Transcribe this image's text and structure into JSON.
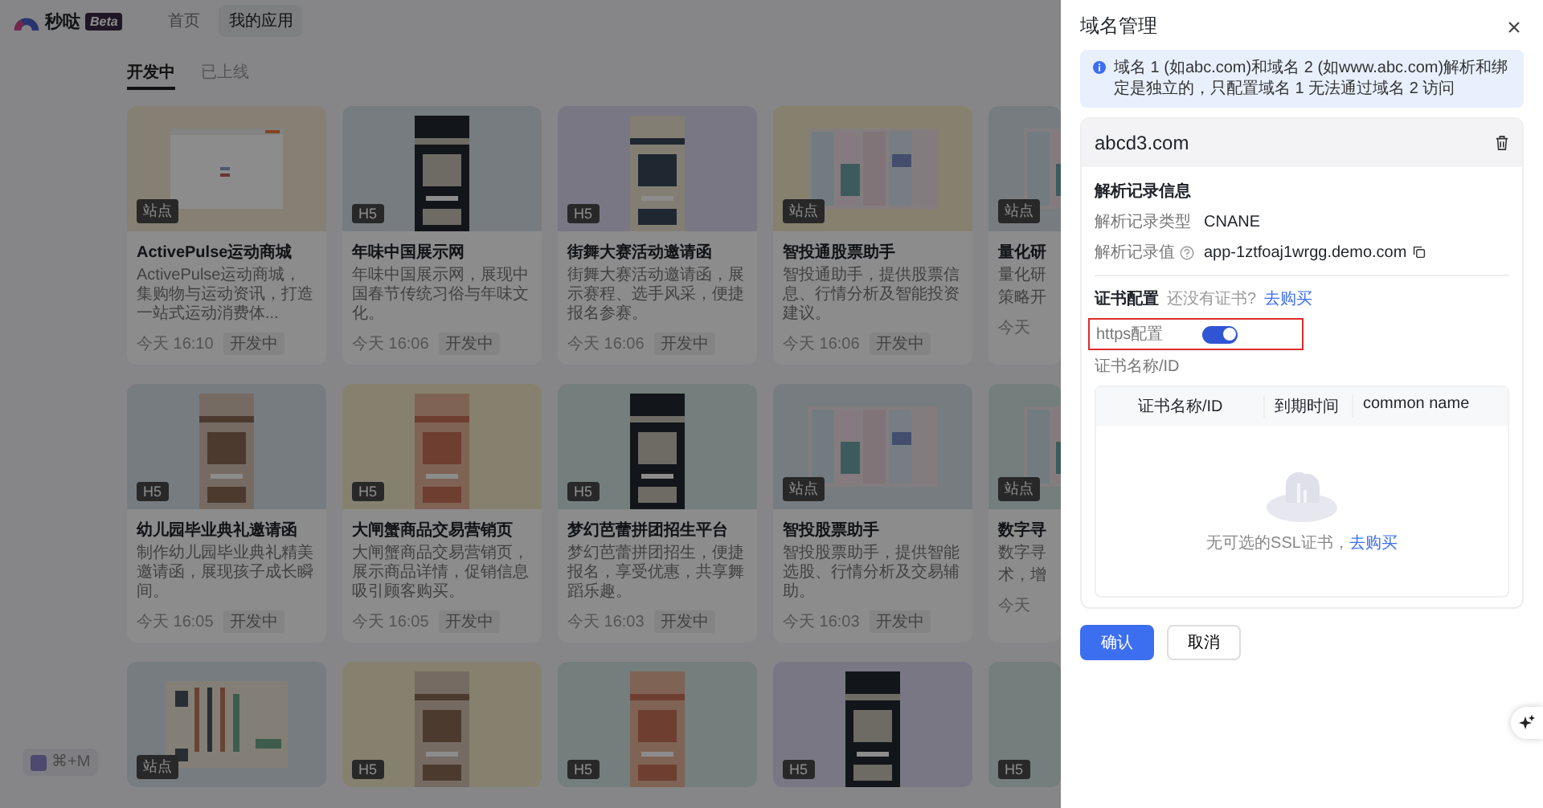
{
  "header": {
    "logo_text": "秒哒",
    "logo_badge": "Beta",
    "nav": [
      {
        "label": "首页",
        "selected": false
      },
      {
        "label": "我的应用",
        "selected": true
      }
    ]
  },
  "tabs": [
    {
      "label": "开发中",
      "selected": true
    },
    {
      "label": "已上线",
      "selected": false
    }
  ],
  "cards": [
    {
      "kind": "full",
      "badge": "站点",
      "title": "ActivePulse运动商城",
      "desc": "ActivePulse运动商城，集购物与运动资讯，打造一站式运动消费体...",
      "time": "今天 16:10",
      "status": "开发中"
    },
    {
      "kind": "full",
      "badge": "H5",
      "title": "年味中国展示网",
      "desc": "年味中国展示网，展现中国春节传统习俗与年味文化。",
      "time": "今天 16:06",
      "status": "开发中"
    },
    {
      "kind": "full",
      "badge": "H5",
      "title": "街舞大赛活动邀请函",
      "desc": "街舞大赛活动邀请函，展示赛程、选手风采，便捷报名参赛。",
      "time": "今天 16:06",
      "status": "开发中"
    },
    {
      "kind": "full",
      "badge": "站点",
      "title": "智投通股票助手",
      "desc": "智投通助手，提供股票信息、行情分析及智能投资建议。",
      "time": "今天 16:06",
      "status": "开发中"
    },
    {
      "kind": "partial",
      "badge": "站点",
      "title": "量化研",
      "desc_lines": [
        "量化研",
        "策略开"
      ],
      "time": "今天"
    },
    {
      "kind": "full",
      "badge": "H5",
      "title": "幼儿园毕业典礼邀请函",
      "desc": "制作幼儿园毕业典礼精美邀请函，展现孩子成长瞬间。",
      "time": "今天 16:05",
      "status": "开发中"
    },
    {
      "kind": "full",
      "badge": "H5",
      "title": "大闸蟹商品交易营销页",
      "desc": "大闸蟹商品交易营销页，展示商品详情，促销信息吸引顾客购买。",
      "time": "今天 16:05",
      "status": "开发中"
    },
    {
      "kind": "full",
      "badge": "H5",
      "title": "梦幻芭蕾拼团招生平台",
      "desc": "梦幻芭蕾拼团招生，便捷报名，享受优惠，共享舞蹈乐趣。",
      "time": "今天 16:03",
      "status": "开发中"
    },
    {
      "kind": "full",
      "badge": "站点",
      "title": "智投股票助手",
      "desc": "智投股票助手，提供智能选股、行情分析及交易辅助。",
      "time": "今天 16:03",
      "status": "开发中"
    },
    {
      "kind": "partial",
      "badge": "站点",
      "title": "数字寻",
      "desc_lines": [
        "数字寻",
        "术，增"
      ],
      "time": "今天"
    },
    {
      "kind": "full",
      "badge": "站点"
    },
    {
      "kind": "full",
      "badge": "H5"
    },
    {
      "kind": "full",
      "badge": "H5"
    },
    {
      "kind": "full",
      "badge": "H5"
    },
    {
      "kind": "partial",
      "badge": "H5"
    }
  ],
  "shortcut": {
    "label": "⌘+M"
  },
  "drawer": {
    "title": "域名管理",
    "notice": "域名 1 (如abc.com)和域名 2 (如www.abc.com)解析和绑定是独立的，只配置域名 1 无法通过域名 2 访问",
    "domain": "abcd3.com",
    "record_section": "解析记录信息",
    "records": [
      {
        "kind": "plain",
        "label": "解析记录类型",
        "value": "CNANE"
      },
      {
        "kind": "help_copy",
        "label": "解析记录值",
        "value": "app-1ztfoaj1wrgg.demo.com"
      }
    ],
    "cert_section": "证书配置",
    "cert_hint": "还没有证书?",
    "cert_link": "去购买",
    "https": {
      "label": "https配置",
      "on": true,
      "highlighted": true
    },
    "cert_field_label": "证书名称/ID",
    "table": {
      "columns": [
        "证书名称/ID",
        "到期时间",
        "common name"
      ],
      "empty_text": "无可选的SSL证书，",
      "empty_link": "去购买"
    },
    "buttons": [
      {
        "kind": "primary",
        "label": "确认"
      },
      {
        "kind": "default",
        "label": "取消"
      }
    ]
  }
}
